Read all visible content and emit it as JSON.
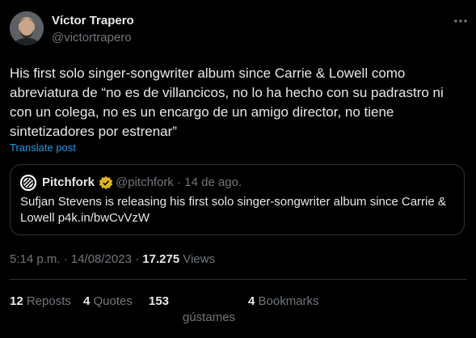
{
  "author": {
    "name": "Víctor Trapero",
    "handle": "@victortrapero"
  },
  "tweet": {
    "text": "His first solo singer-songwriter album since Carrie & Lowell como abreviatura de “no es de villancicos, no lo ha hecho con su padrastro ni con un colega, no es un encargo de un amigo director, no tiene sintetizadores por estrenar”",
    "translate_label": "Translate post"
  },
  "quote": {
    "name": "Pitchfork",
    "handle_date": "@pitchfork · 14 de ago.",
    "text": "Sufjan Stevens is releasing his first solo singer-songwriter album since Carrie & Lowell p4k.in/bwCvVzW"
  },
  "meta": {
    "datetime": "5:14 p.m. · 14/08/2023 · ",
    "views_count": "17.275",
    "views_label": " Views"
  },
  "stats": {
    "reposts_count": "12",
    "reposts_label": " Reposts",
    "quotes_count": "4",
    "quotes_label": " Quotes",
    "likes_count": "153",
    "likes_label": "gústames",
    "bookmarks_count": "4",
    "bookmarks_label": " Bookmarks"
  },
  "icons": {
    "more": "more-dots-icon",
    "verified": "verified-badge-icon",
    "quote_avatar": "pitchfork-logo-icon"
  },
  "colors": {
    "background": "#000000",
    "text": "#e7e9ea",
    "muted": "#71767b",
    "link": "#1d9bf0",
    "border": "#2f3336",
    "verified_gold": "#e2b719"
  }
}
